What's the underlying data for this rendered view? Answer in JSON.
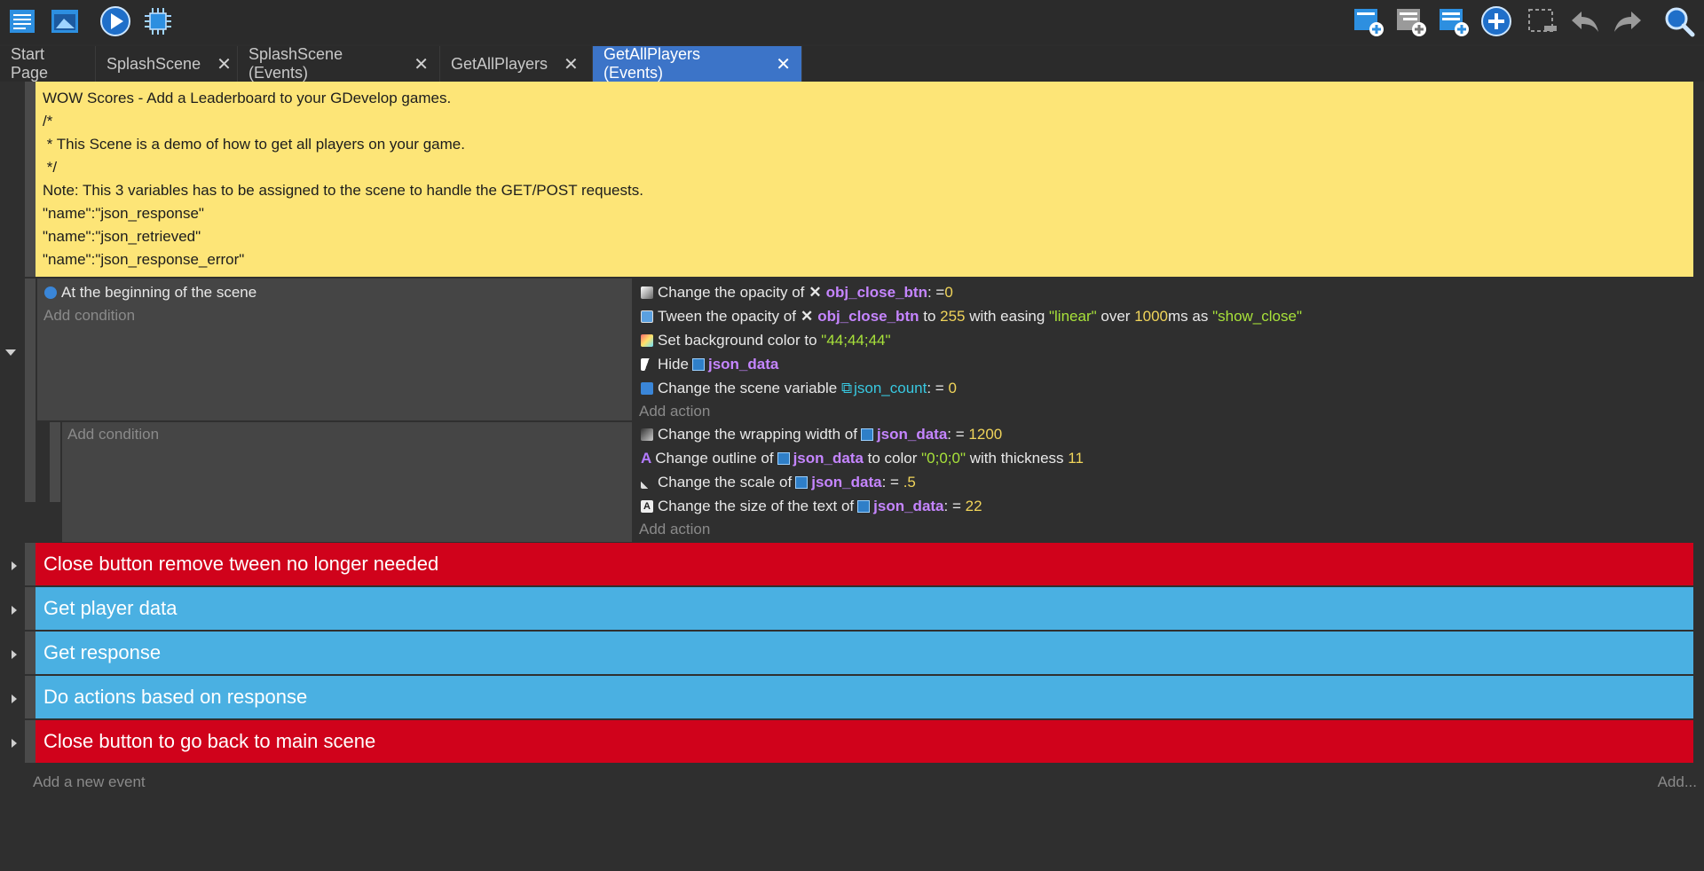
{
  "toolbar": {
    "left_icons": [
      "project-manager-icon",
      "scene-properties-icon",
      "preview-icon",
      "debugger-icon"
    ],
    "right_icons": [
      "add-event-icon",
      "add-subevent-icon",
      "add-other-icon",
      "add-plus-icon",
      "delete-icon",
      "undo-icon",
      "redo-icon",
      "search-icon"
    ]
  },
  "tabs": [
    {
      "label": "Start Page",
      "closable": false
    },
    {
      "label": "SplashScene",
      "closable": true
    },
    {
      "label": "SplashScene (Events)",
      "closable": true
    },
    {
      "label": "GetAllPlayers",
      "closable": true
    },
    {
      "label": "GetAllPlayers (Events)",
      "closable": true,
      "active": true
    }
  ],
  "comment": {
    "lines": [
      "WOW Scores - Add a Leaderboard to your GDevelop games.",
      "/*",
      " * This Scene is a demo of how to get all players on your game.",
      " */",
      "Note: This 3 variables has to be assigned to the scene to handle the GET/POST requests.",
      "\"name\":\"json_response\"",
      "\"name\":\"json_retrieved\"",
      "\"name\":\"json_response_error\""
    ]
  },
  "event1": {
    "condition": "At the beginning of the scene",
    "add_condition": "Add condition",
    "add_action": "Add action",
    "a1": {
      "t1": "Change the opacity of",
      "obj": "obj_close_btn",
      "t2": ": = ",
      "v": "0"
    },
    "a2": {
      "t1": "Tween the opacity of",
      "obj": "obj_close_btn",
      "t2": " to ",
      "v1": "255",
      "t3": " with easing ",
      "s1": "\"linear\"",
      "t4": " over ",
      "v2": "1000",
      "t5": "ms as ",
      "s2": "\"show_close\""
    },
    "a3": {
      "t1": "Set background color to ",
      "s": "\"44;44;44\""
    },
    "a4": {
      "t1": "Hide",
      "obj": "json_data"
    },
    "a5": {
      "t1": "Change the scene variable ",
      "var": "json_count",
      "t2": ": = ",
      "v": "0"
    }
  },
  "subevent": {
    "add_condition": "Add condition",
    "add_action": "Add action",
    "a1": {
      "t1": "Change the wrapping width of",
      "obj": "json_data",
      "t2": ": = ",
      "v": "1200"
    },
    "a2": {
      "t1": "Change outline of",
      "obj": "json_data",
      "t2": " to color ",
      "s": "\"0;0;0\"",
      "t3": " with thickness ",
      "v": "11"
    },
    "a3": {
      "t1": "Change the scale of",
      "obj": "json_data",
      "t2": ": = ",
      "v": ".5"
    },
    "a4": {
      "t1": "Change the size of the text of",
      "obj": "json_data",
      "t2": ": = ",
      "v": "22"
    }
  },
  "groups": [
    {
      "label": "Close button remove tween no longer needed",
      "color": "#d0021b"
    },
    {
      "label": "Get player data",
      "color": "#4ab0e2"
    },
    {
      "label": "Get response",
      "color": "#4ab0e2"
    },
    {
      "label": "Do actions based on response",
      "color": "#4ab0e2"
    },
    {
      "label": "Close button to go back to main scene",
      "color": "#d0021b"
    }
  ],
  "footer": {
    "add_event": "Add a new event",
    "add_other": "Add..."
  }
}
